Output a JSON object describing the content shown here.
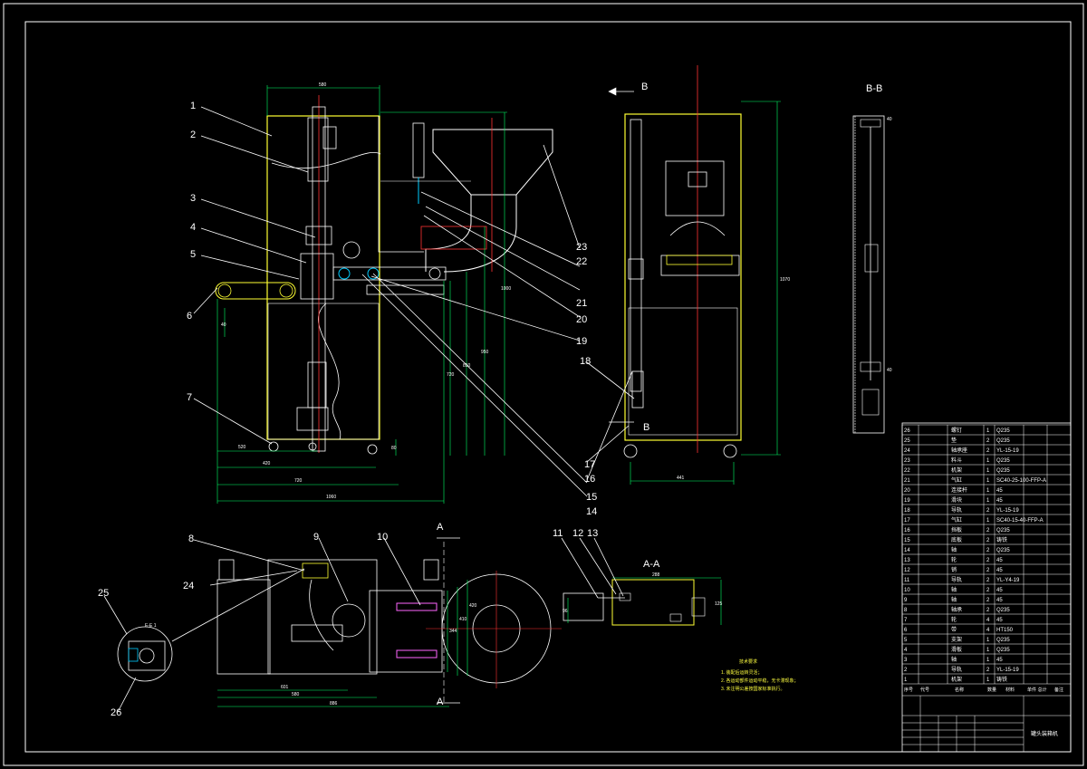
{
  "colors": {
    "background": "#000000",
    "frame": "#ffffff",
    "outline": "#ffff33",
    "center_line": "#ff3333",
    "dimension": "#00ff66",
    "hidden": "#ff66ff",
    "part": "#ffffff",
    "note": "#ffff40"
  },
  "part_labels": [
    "1",
    "2",
    "3",
    "4",
    "5",
    "6",
    "7",
    "8",
    "9",
    "10",
    "11",
    "12",
    "13",
    "14",
    "15",
    "16",
    "17",
    "18",
    "19",
    "20",
    "21",
    "22",
    "23",
    "24",
    "25",
    "26"
  ],
  "section_labels": {
    "bb_title": "B-B",
    "aa_title": "A-A",
    "a_top": "A",
    "a_bottom": "A",
    "b_top": "B",
    "b_side": "B"
  },
  "dimensions": {
    "front_top_width": "580",
    "front_h40": "40",
    "front_d_bottom": "80",
    "front_w1": "520",
    "front_w2": "420",
    "front_w3": "720",
    "front_w4": "1060",
    "front_v1": "720",
    "front_v2": "850",
    "front_v3": "950",
    "front_v4": "1000",
    "side_height": "1070",
    "side_width": "441",
    "top_w1": "601",
    "top_w2": "580",
    "top_w3": "886",
    "top_h1": "344",
    "top_h2": "410",
    "top_h3": "420",
    "aa_w": "288",
    "aa_h": "125",
    "aa_h2": "96",
    "bb_d1": "40",
    "bb_d2": "40",
    "detail_tag": "E-E 1"
  },
  "notes": {
    "title": "技术要求",
    "lines": [
      "1. 装配后运转灵活；",
      "2. 各运动部件运动平稳，无卡滞现象；",
      "3. 未注明公差按国家标准执行。"
    ]
  },
  "bom": {
    "rows": [
      {
        "no": "26",
        "name": "螺钉",
        "qty": "1",
        "material": "Q235"
      },
      {
        "no": "25",
        "name": "垫",
        "qty": "2",
        "material": "Q235"
      },
      {
        "no": "24",
        "name": "轴承座",
        "qty": "2",
        "material": "YL-15-19"
      },
      {
        "no": "23",
        "name": "料斗",
        "qty": "1",
        "material": "Q235"
      },
      {
        "no": "22",
        "name": "机架",
        "qty": "1",
        "material": "Q235"
      },
      {
        "no": "21",
        "name": "气缸",
        "qty": "1",
        "material": "SC40-25-100-FFP-A"
      },
      {
        "no": "20",
        "name": "连接杆",
        "qty": "1",
        "material": "45"
      },
      {
        "no": "19",
        "name": "滑块",
        "qty": "1",
        "material": "45"
      },
      {
        "no": "18",
        "name": "导轨",
        "qty": "2",
        "material": "YL-15-19"
      },
      {
        "no": "17",
        "name": "气缸",
        "qty": "1",
        "material": "SC40-15-40-FFP-A"
      },
      {
        "no": "16",
        "name": "挡板",
        "qty": "2",
        "material": "Q235"
      },
      {
        "no": "15",
        "name": "底板",
        "qty": "2",
        "material": "铸铁"
      },
      {
        "no": "14",
        "name": "轴",
        "qty": "2",
        "material": "Q235"
      },
      {
        "no": "13",
        "name": "轮",
        "qty": "2",
        "material": "45"
      },
      {
        "no": "12",
        "name": "销",
        "qty": "2",
        "material": "45"
      },
      {
        "no": "11",
        "name": "导轨",
        "qty": "2",
        "material": "YL-Y4-19"
      },
      {
        "no": "10",
        "name": "轴",
        "qty": "2",
        "material": "45"
      },
      {
        "no": "9",
        "name": "轴",
        "qty": "2",
        "material": "45"
      },
      {
        "no": "8",
        "name": "轴承",
        "qty": "2",
        "material": "Q235"
      },
      {
        "no": "7",
        "name": "轮",
        "qty": "4",
        "material": "45"
      },
      {
        "no": "6",
        "name": "带",
        "qty": "4",
        "material": "HT150"
      },
      {
        "no": "5",
        "name": "支架",
        "qty": "1",
        "material": "Q235"
      },
      {
        "no": "4",
        "name": "滑板",
        "qty": "1",
        "material": "Q235"
      },
      {
        "no": "3",
        "name": "轴",
        "qty": "1",
        "material": "45"
      },
      {
        "no": "2",
        "name": "导轨",
        "qty": "2",
        "material": "YL-15-19"
      },
      {
        "no": "1",
        "name": "机架",
        "qty": "1",
        "material": "铸铁"
      }
    ],
    "headers": [
      "序号",
      "代号",
      "名称",
      "数量",
      "材料",
      "单件 总计",
      "备注"
    ],
    "drawing_title": "罐头装箱机"
  }
}
